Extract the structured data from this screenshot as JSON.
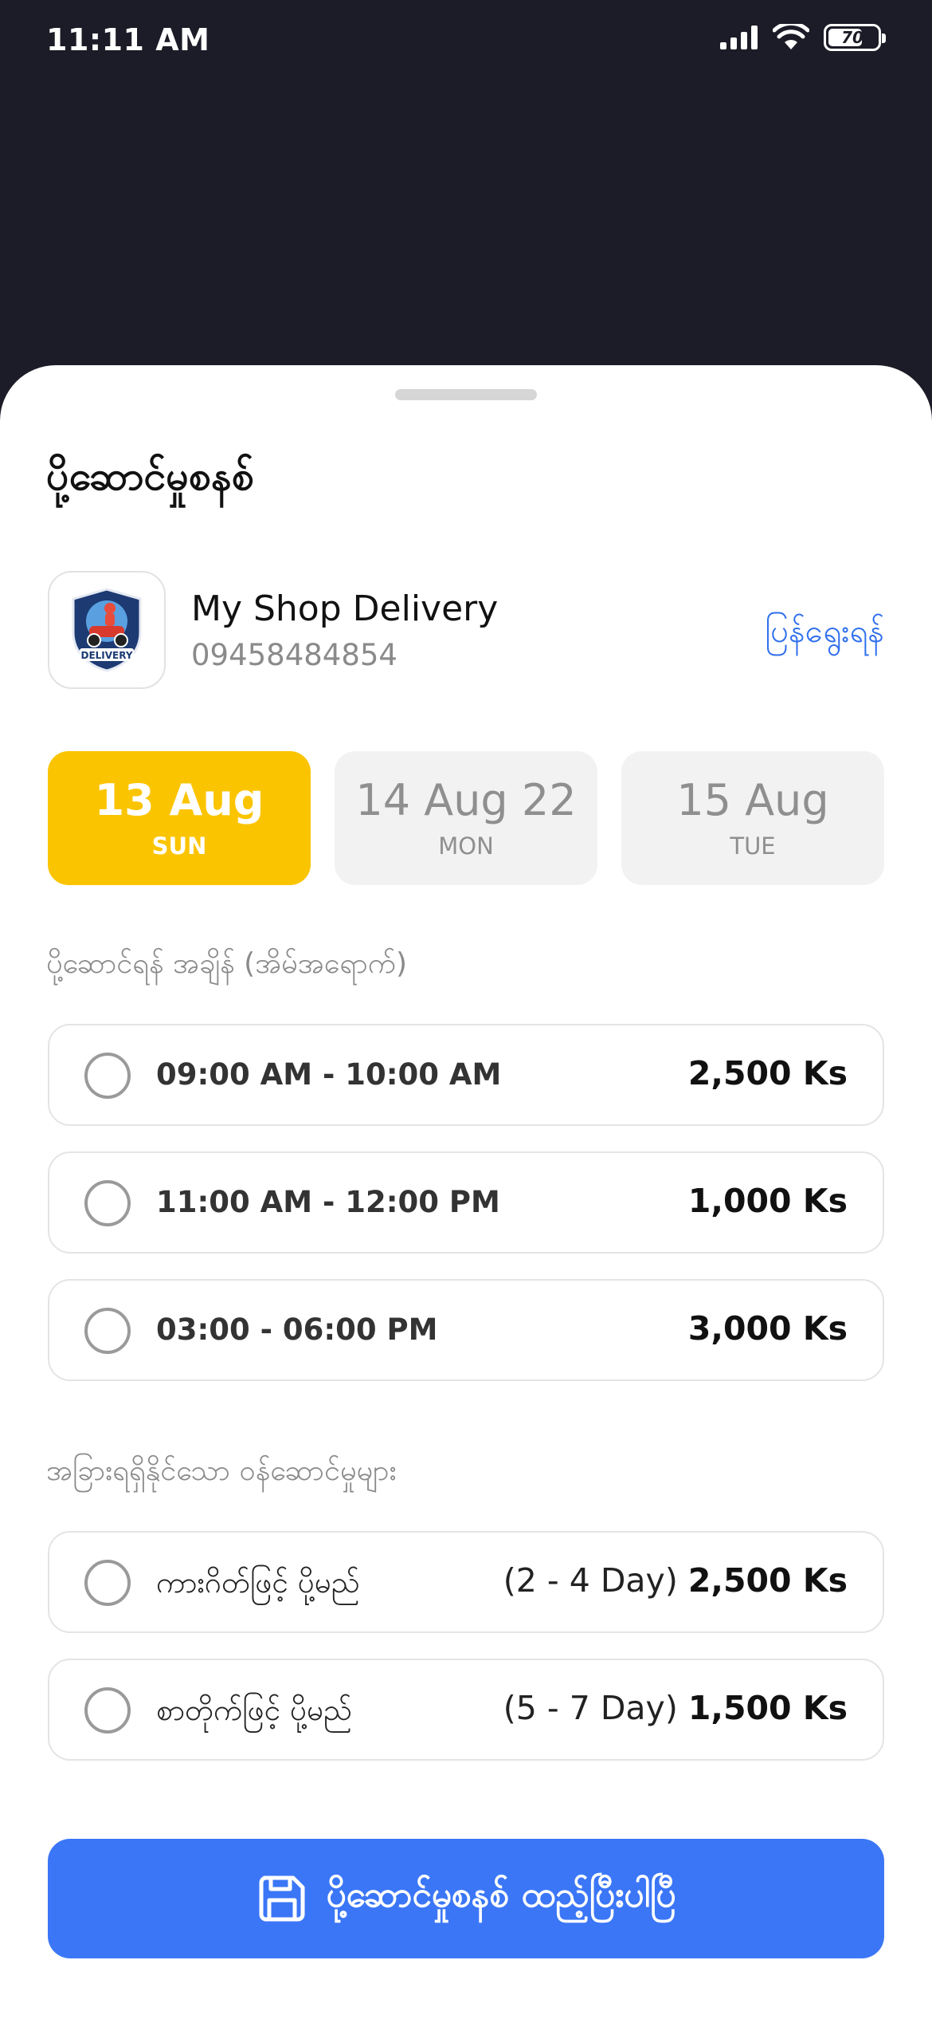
{
  "status_bar": {
    "time": "11:11 AM",
    "battery": "70",
    "battery_level": 0.7
  },
  "sheet": {
    "title": "ပို့ဆောင်မှုစနစ်"
  },
  "shop": {
    "name": "My Shop Delivery",
    "phone": "09458484854",
    "change_label": "ပြန်ရွေးရန်",
    "logo_text": "DELIVERY"
  },
  "dates": [
    {
      "date": "13 Aug",
      "day": "SUN",
      "selected": true
    },
    {
      "date": "14 Aug 22",
      "day": "MON",
      "selected": false
    },
    {
      "date": "15 Aug",
      "day": "TUE",
      "selected": false
    }
  ],
  "time_section": {
    "label": "ပို့ဆောင်ရန် အချိန် (အိမ်အရောက်)",
    "slots": [
      {
        "time": "09:00 AM - 10:00 AM",
        "price": "2,500 Ks"
      },
      {
        "time": "11:00 AM - 12:00 PM",
        "price": "1,000 Ks"
      },
      {
        "time": "03:00 - 06:00 PM",
        "price": "3,000 Ks"
      }
    ]
  },
  "other_section": {
    "label": "အခြားရရှိနိုင်သော ဝန်ဆောင်မှုများ",
    "services": [
      {
        "name": "ကားဂိတ်ဖြင့် ပို့မည်",
        "duration": "(2 - 4 Day)",
        "price": "2,500 Ks"
      },
      {
        "name": "စာတိုက်ဖြင့် ပို့မည်",
        "duration": "(5 - 7 Day)",
        "price": "1,500 Ks"
      }
    ]
  },
  "save_button": {
    "label": "ပို့ဆောင်မှုစနစ် ထည့်ပြီးပါပြီ"
  },
  "colors": {
    "background_dark": "#1c1c28",
    "accent_yellow": "#fbc400",
    "accent_blue": "#3b76f6",
    "link_blue": "#2f6fed"
  }
}
